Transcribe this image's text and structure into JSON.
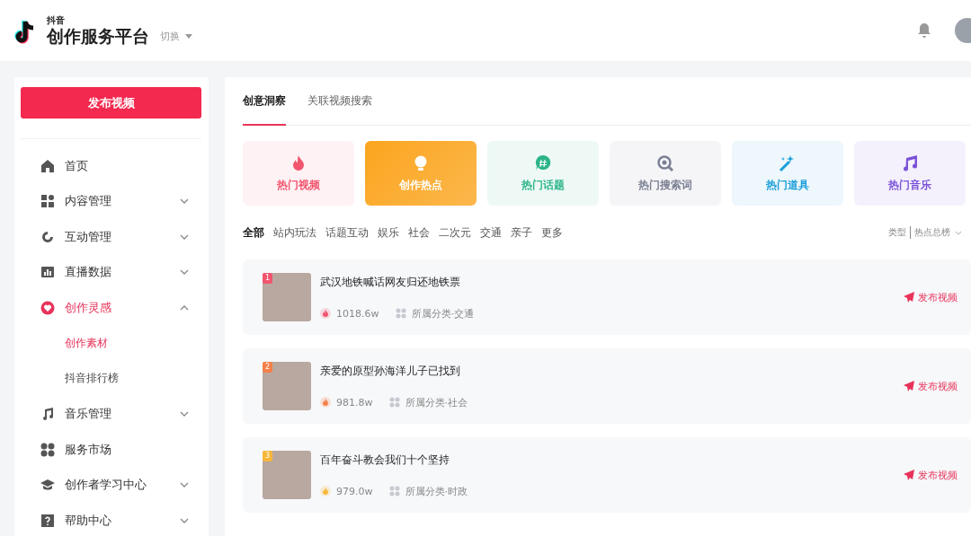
{
  "header": {
    "brand_small": "抖音",
    "brand": "创作服务平台",
    "switch": "切换"
  },
  "sidebar": {
    "publish_button": "发布视频",
    "items": [
      {
        "kind": "home",
        "label": "首页",
        "selected": false
      },
      {
        "kind": "grid",
        "label": "内容管理",
        "expanded": false,
        "selected": false
      },
      {
        "kind": "cycle",
        "label": "互动管理",
        "expanded": false,
        "selected": false
      },
      {
        "kind": "chart",
        "label": "直播数据",
        "expanded": false,
        "selected": false
      },
      {
        "kind": "heart",
        "label": "创作灵感",
        "expanded": true,
        "selected": true,
        "children": [
          {
            "label": "创作素材",
            "selected": true
          },
          {
            "label": "抖音排行榜",
            "selected": false
          }
        ]
      },
      {
        "kind": "music",
        "label": "音乐管理",
        "expanded": false,
        "selected": false
      },
      {
        "kind": "clover",
        "label": "服务市场",
        "selected": false
      },
      {
        "kind": "cap",
        "label": "创作者学习中心",
        "expanded": false,
        "selected": false
      },
      {
        "kind": "help",
        "label": "帮助中心",
        "expanded": false,
        "selected": false
      }
    ]
  },
  "tabs": [
    {
      "label": "创意洞察",
      "selected": true
    },
    {
      "label": "关联视频搜索",
      "selected": false
    }
  ],
  "categories": [
    {
      "kind": "flame",
      "label": "热门视频",
      "color": "#f2566f",
      "selected": false
    },
    {
      "kind": "bulb",
      "label": "创作热点",
      "color": "#fba51f",
      "selected": true
    },
    {
      "kind": "hash",
      "label": "热门话题",
      "color": "#2cb489",
      "selected": false
    },
    {
      "kind": "search",
      "label": "热门搜索词",
      "color": "#7b7f93",
      "selected": false
    },
    {
      "kind": "wand",
      "label": "热门道具",
      "color": "#1a9ed8",
      "selected": false
    },
    {
      "kind": "note",
      "label": "热门音乐",
      "color": "#7a52d8",
      "selected": false
    }
  ],
  "filters": [
    {
      "label": "全部",
      "selected": true
    },
    {
      "label": "站内玩法",
      "selected": false
    },
    {
      "label": "话题互动",
      "selected": false
    },
    {
      "label": "娱乐",
      "selected": false
    },
    {
      "label": "社会",
      "selected": false
    },
    {
      "label": "二次元",
      "selected": false
    },
    {
      "label": "交通",
      "selected": false
    },
    {
      "label": "亲子",
      "selected": false
    },
    {
      "label": "更多",
      "selected": false
    }
  ],
  "sort": {
    "label": "类型",
    "value": "热点总榜"
  },
  "rows": [
    {
      "rank": "1",
      "color": "#f2566f",
      "title": "武汉地铁喊话网友归还地铁票",
      "heat": "1018.6w",
      "category": "所属分类·交通",
      "action": "发布视频"
    },
    {
      "rank": "2",
      "color": "#f6804a",
      "title": "亲爱的原型孙海洋儿子已找到",
      "heat": "981.8w",
      "category": "所属分类·社会",
      "action": "发布视频"
    },
    {
      "rank": "3",
      "color": "#f8b73a",
      "title": "百年奋斗教会我们十个坚持",
      "heat": "979.0w",
      "category": "所属分类·时政",
      "action": "发布视频"
    }
  ]
}
